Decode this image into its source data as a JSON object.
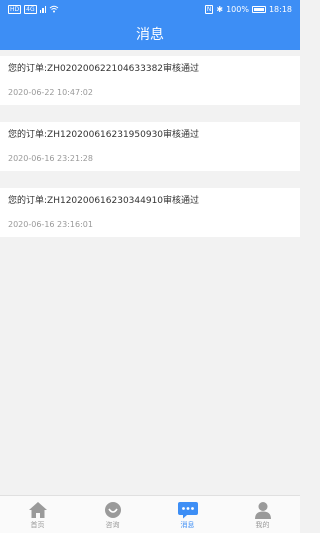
{
  "status_bar": {
    "left_badge_1": "HD",
    "left_badge_2": "4G",
    "nfc": "N",
    "bluetooth": "✱",
    "battery_percent": "100%",
    "time": "18:18"
  },
  "header": {
    "title": "消息"
  },
  "messages": [
    {
      "text": "您的订单:ZH020200622104633382审核通过",
      "time": "2020-06-22 10:47:02"
    },
    {
      "text": "您的订单:ZH120200616231950930审核通过",
      "time": "2020-06-16 23:21:28"
    },
    {
      "text": "您的订单:ZH120200616230344910审核通过",
      "time": "2020-06-16 23:16:01"
    }
  ],
  "tabbar": {
    "active": "消息",
    "colors": {
      "accent": "#3d8ef5",
      "inactive": "#9a9a9a"
    },
    "items": [
      {
        "label": "首页",
        "icon": "home-icon"
      },
      {
        "label": "咨询",
        "icon": "consult-icon"
      },
      {
        "label": "消息",
        "icon": "message-icon"
      },
      {
        "label": "我的",
        "icon": "user-icon"
      }
    ]
  }
}
